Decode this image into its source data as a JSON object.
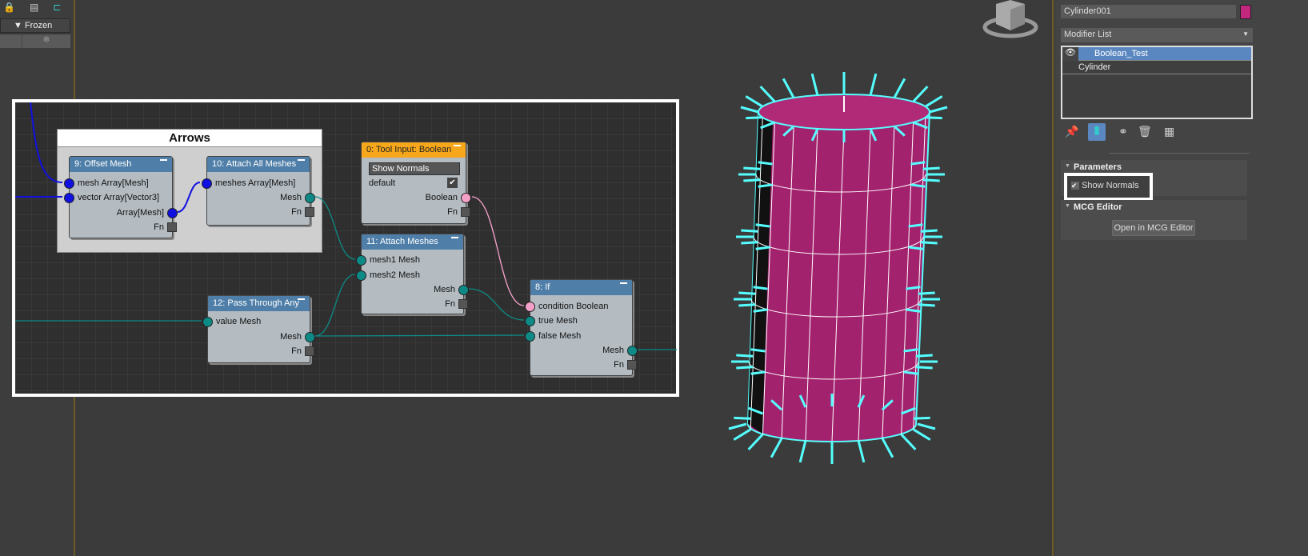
{
  "left_panel": {
    "column_header": "Frozen",
    "frozen_cell": "❄"
  },
  "graph": {
    "group_title": "Arrows",
    "nodes": [
      {
        "id": "n9",
        "title": "9: Offset Mesh",
        "color": "blue",
        "inputs": [
          "mesh Array[Mesh]",
          "vector Array[Vector3]"
        ],
        "outputs": [
          "Array[Mesh]"
        ],
        "fn": "Fn"
      },
      {
        "id": "n10",
        "title": "10: Attach All Meshes",
        "color": "blue",
        "inputs": [
          "meshes Array[Mesh]"
        ],
        "outputs": [
          "Mesh"
        ],
        "fn": "Fn"
      },
      {
        "id": "n0",
        "title": "0: Tool Input: Boolean",
        "color": "orange",
        "field": "Show Normals",
        "default_label": "default",
        "default_checked": true,
        "outputs": [
          "Boolean"
        ],
        "fn": "Fn"
      },
      {
        "id": "n11",
        "title": "11: Attach Meshes",
        "color": "blue",
        "inputs": [
          "mesh1 Mesh",
          "mesh2 Mesh"
        ],
        "outputs": [
          "Mesh"
        ],
        "fn": "Fn"
      },
      {
        "id": "n12",
        "title": "12: Pass Through Any",
        "color": "blue",
        "inputs": [
          "value Mesh"
        ],
        "outputs": [
          "Mesh"
        ],
        "fn": "Fn"
      },
      {
        "id": "n8",
        "title": "8: If",
        "color": "blue",
        "inputs": [
          "condition Boolean",
          "true Mesh",
          "false Mesh"
        ],
        "outputs": [
          "Mesh"
        ],
        "fn": "Fn"
      }
    ],
    "colors": {
      "mesh": "#0e8a86",
      "array": "#1010e0",
      "boolean": "#f4a0c8"
    }
  },
  "command_panel": {
    "object_name": "Cylinder001",
    "object_color": "#c4287e",
    "modifier_list": "Modifier List",
    "stack": [
      "Boolean_Test",
      "Cylinder"
    ],
    "parameters_title": "Parameters",
    "show_normals_label": "Show Normals",
    "show_normals_checked": true,
    "mcg_title": "MCG Editor",
    "open_mcg_button": "Open in MCG Editor"
  }
}
